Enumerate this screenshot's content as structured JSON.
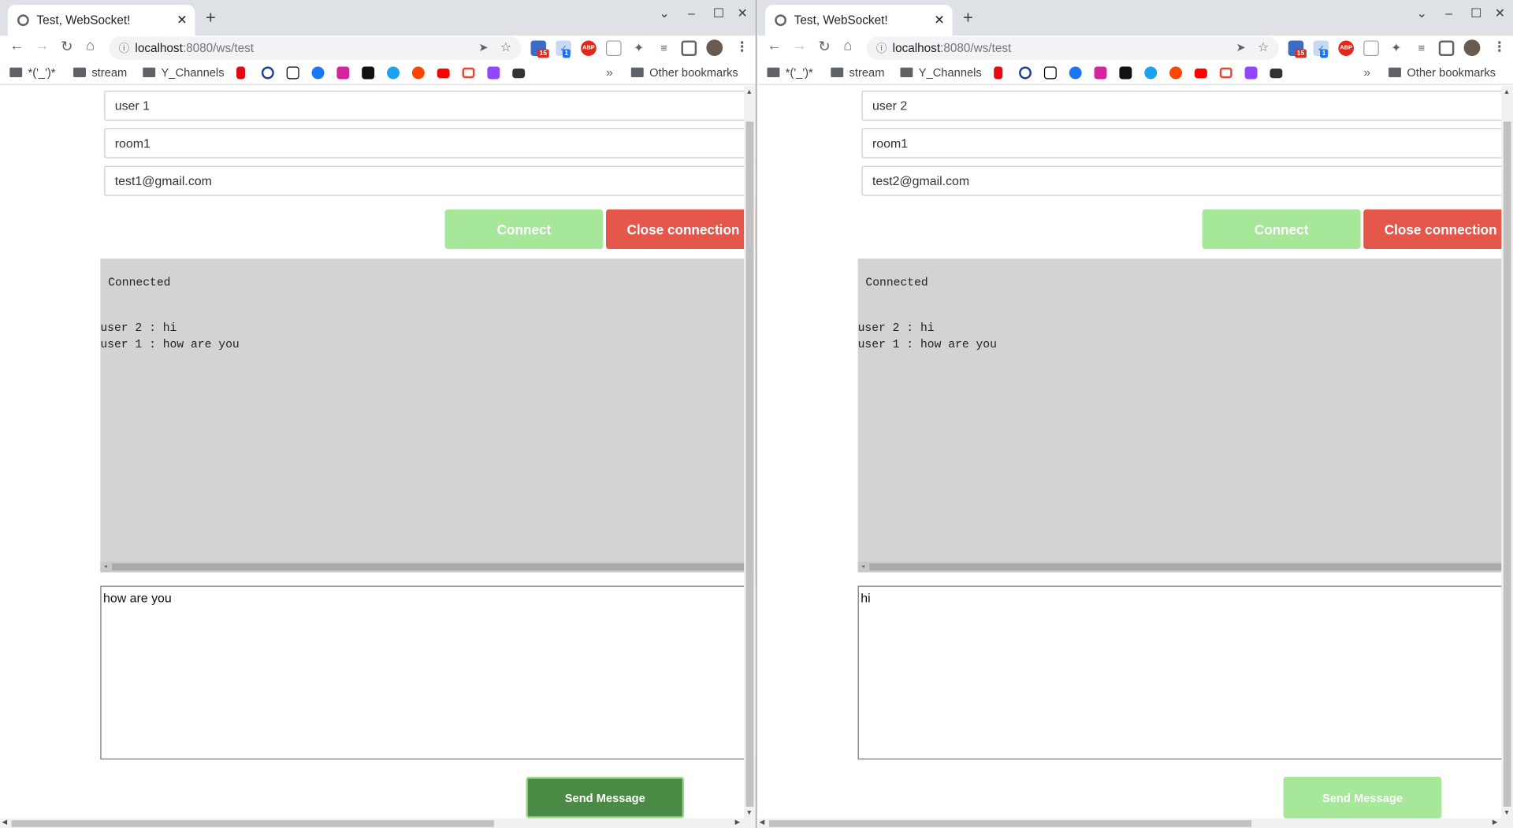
{
  "windows": [
    {
      "tab": {
        "title": "Test, WebSocket!"
      },
      "url": {
        "host": "localhost",
        "path": ":8080/ws/test"
      },
      "ext_badges": [
        "15",
        "1"
      ],
      "abp_label": "ABP",
      "bookmarks": [
        "*('_')*",
        "stream",
        "Y_Channels"
      ],
      "other_bookmarks": "Other bookmarks",
      "form": {
        "user": "user 1",
        "room": "room1",
        "email": "test1@gmail.com"
      },
      "buttons": {
        "connect": "Connect",
        "close": "Close connection",
        "send": "Send Message"
      },
      "log": {
        "status": "Connected",
        "messages": [
          "user 2 : hi",
          "user 1 : how are you"
        ]
      },
      "message_input": "how are you",
      "send_state": "active"
    },
    {
      "tab": {
        "title": "Test, WebSocket!"
      },
      "url": {
        "host": "localhost",
        "path": ":8080/ws/test"
      },
      "ext_badges": [
        "15",
        "1"
      ],
      "abp_label": "ABP",
      "bookmarks": [
        "*('_')*",
        "stream",
        "Y_Channels"
      ],
      "other_bookmarks": "Other bookmarks",
      "form": {
        "user": "user 2",
        "room": "room1",
        "email": "test2@gmail.com"
      },
      "buttons": {
        "connect": "Connect",
        "close": "Close connection",
        "send": "Send Message"
      },
      "log": {
        "status": "Connected",
        "messages": [
          "user 2 : hi",
          "user 1 : how are you"
        ]
      },
      "message_input": "hi",
      "send_state": "disabled"
    }
  ],
  "colors": {
    "connect_disabled": "#a6e79a",
    "close_button": "#e6574b",
    "send_active": "#4a8a45",
    "log_background": "#d3d3d3"
  }
}
